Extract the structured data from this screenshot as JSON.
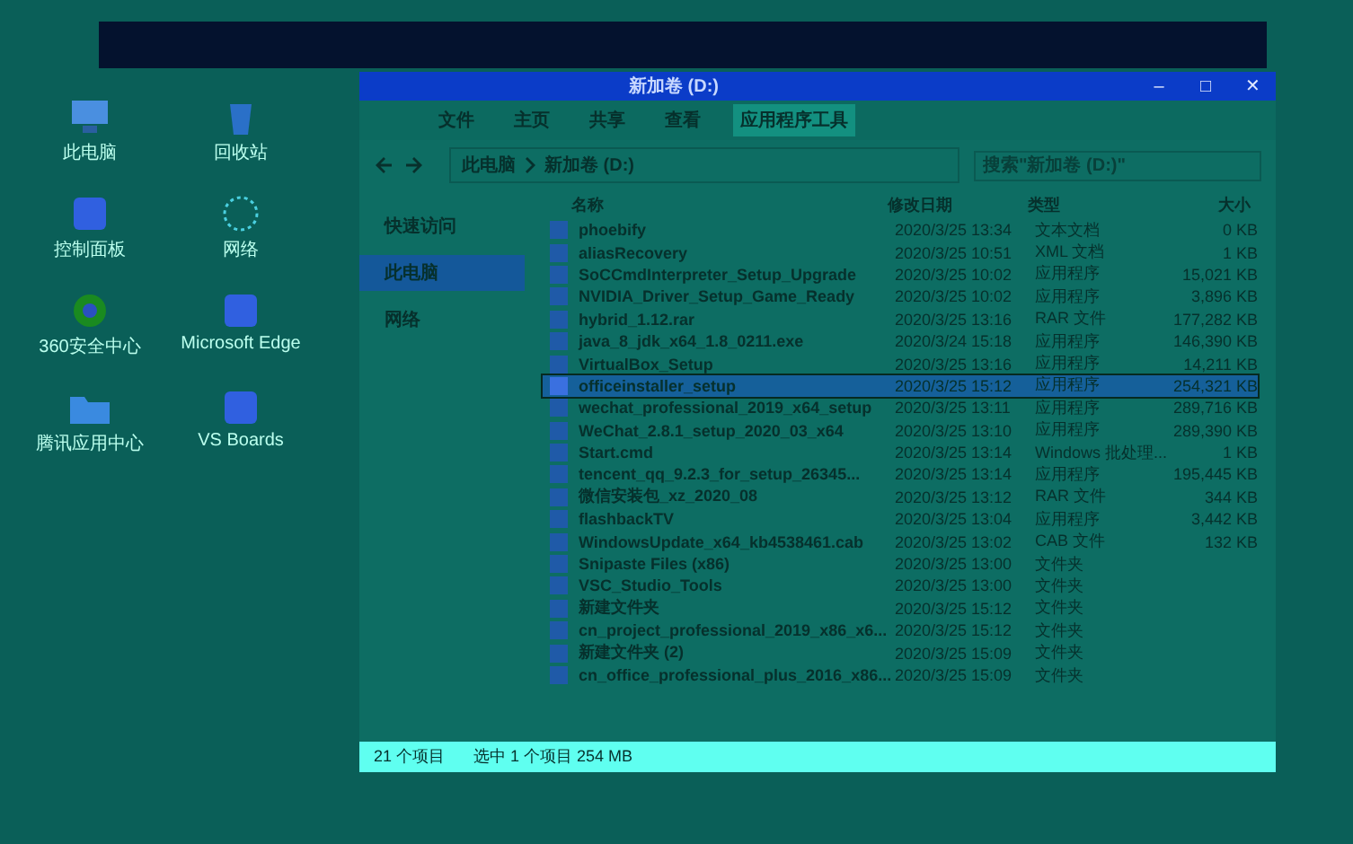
{
  "desktop_icons": [
    {
      "label": "此电脑",
      "kind": "computer"
    },
    {
      "label": "回收站",
      "kind": "recycle"
    },
    {
      "label": "控制面板",
      "kind": "panel"
    },
    {
      "label": "网络",
      "kind": "network"
    },
    {
      "label": "360安全中心",
      "kind": "shield"
    },
    {
      "label": "Microsoft Edge",
      "kind": "app"
    },
    {
      "label": "腾讯应用中心",
      "kind": "folder"
    },
    {
      "label": "VS Boards",
      "kind": "app"
    }
  ],
  "window": {
    "title": "新加卷 (D:)",
    "controls": [
      "‒",
      "□",
      "✕"
    ]
  },
  "ribbon_tabs": [
    {
      "label": "文件",
      "selected": false
    },
    {
      "label": "主页",
      "selected": false
    },
    {
      "label": "共享",
      "selected": false
    },
    {
      "label": "查看",
      "selected": false
    },
    {
      "label": "应用程序工具",
      "selected": true
    }
  ],
  "address": {
    "path": [
      "此电脑",
      "新加卷 (D:)"
    ]
  },
  "search": {
    "placeholder": "搜索\"新加卷 (D:)\""
  },
  "nav": [
    {
      "label": "快速访问",
      "selected": false
    },
    {
      "label": "此电脑",
      "selected": true
    },
    {
      "label": "网络",
      "selected": false
    }
  ],
  "table": {
    "columns": [
      "名称",
      "修改日期",
      "类型",
      "大小"
    ],
    "rows": [
      {
        "name": "phoebify",
        "date": "2020/3/25 13:34",
        "type": "文本文档",
        "size": "0 KB",
        "selected": false
      },
      {
        "name": "aliasRecovery",
        "date": "2020/3/25 10:51",
        "type": "XML 文档",
        "size": "1 KB",
        "selected": false
      },
      {
        "name": "SoCCmdInterpreter_Setup_Upgrade",
        "date": "2020/3/25 10:02",
        "type": "应用程序",
        "size": "15,021 KB",
        "selected": false
      },
      {
        "name": "NVIDIA_Driver_Setup_Game_Ready",
        "date": "2020/3/25 10:02",
        "type": "应用程序",
        "size": "3,896 KB",
        "selected": false
      },
      {
        "name": "hybrid_1.12.rar",
        "date": "2020/3/25 13:16",
        "type": "RAR 文件",
        "size": "177,282 KB",
        "selected": false
      },
      {
        "name": "java_8_jdk_x64_1.8_0211.exe",
        "date": "2020/3/24 15:18",
        "type": "应用程序",
        "size": "146,390 KB",
        "selected": false
      },
      {
        "name": "VirtualBox_Setup",
        "date": "2020/3/25 13:16",
        "type": "应用程序",
        "size": "14,211 KB",
        "selected": false
      },
      {
        "name": "officeinstaller_setup",
        "date": "2020/3/25 15:12",
        "type": "应用程序",
        "size": "254,321 KB",
        "selected": true
      },
      {
        "name": "wechat_professional_2019_x64_setup",
        "date": "2020/3/25 13:11",
        "type": "应用程序",
        "size": "289,716 KB",
        "selected": false
      },
      {
        "name": "WeChat_2.8.1_setup_2020_03_x64",
        "date": "2020/3/25 13:10",
        "type": "应用程序",
        "size": "289,390 KB",
        "selected": false
      },
      {
        "name": "Start.cmd",
        "date": "2020/3/25 13:14",
        "type": "Windows 批处理...",
        "size": "1 KB",
        "selected": false
      },
      {
        "name": "tencent_qq_9.2.3_for_setup_26345...",
        "date": "2020/3/25 13:14",
        "type": "应用程序",
        "size": "195,445 KB",
        "selected": false
      },
      {
        "name": "微信安装包_xz_2020_08",
        "date": "2020/3/25 13:12",
        "type": "RAR 文件",
        "size": "344 KB",
        "selected": false
      },
      {
        "name": "flashbackTV",
        "date": "2020/3/25 13:04",
        "type": "应用程序",
        "size": "3,442 KB",
        "selected": false
      },
      {
        "name": "WindowsUpdate_x64_kb4538461.cab",
        "date": "2020/3/25 13:02",
        "type": "CAB 文件",
        "size": "132 KB",
        "selected": false
      },
      {
        "name": "Snipaste Files (x86)",
        "date": "2020/3/25 13:00",
        "type": "文件夹",
        "size": "",
        "selected": false
      },
      {
        "name": "VSC_Studio_Tools",
        "date": "2020/3/25 13:00",
        "type": "文件夹",
        "size": "",
        "selected": false
      },
      {
        "name": "新建文件夹",
        "date": "2020/3/25 15:12",
        "type": "文件夹",
        "size": "",
        "selected": false
      },
      {
        "name": "cn_project_professional_2019_x86_x6...",
        "date": "2020/3/25 15:12",
        "type": "文件夹",
        "size": "",
        "selected": false
      },
      {
        "name": "新建文件夹 (2)",
        "date": "2020/3/25 15:09",
        "type": "文件夹",
        "size": "",
        "selected": false
      },
      {
        "name": "cn_office_professional_plus_2016_x86...",
        "date": "2020/3/25 15:09",
        "type": "文件夹",
        "size": "",
        "selected": false
      }
    ]
  },
  "status_bar": {
    "count": "21 个项目",
    "selection": "选中 1 个项目  254 MB"
  }
}
